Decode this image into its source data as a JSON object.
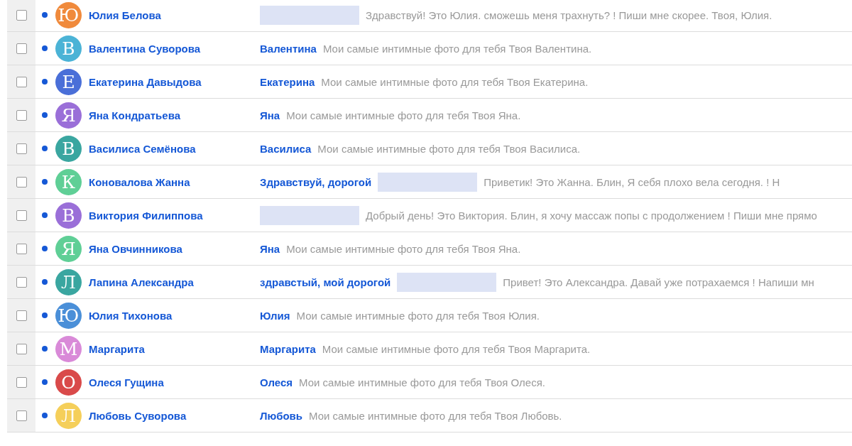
{
  "messages": [
    {
      "sender": "Юлия Белова",
      "initial": "Ю",
      "color": "#f08a3c",
      "unread": true,
      "checked": false,
      "parts": [
        {
          "kind": "redacted"
        },
        {
          "kind": "preview",
          "text": "Здравствуй! Это Юлия. сможешь меня трахнуть? ! Пиши мне скорее. Твоя, Юлия."
        }
      ]
    },
    {
      "sender": "Валентина Суворова",
      "initial": "В",
      "color": "#4bb3d6",
      "unread": true,
      "checked": false,
      "parts": [
        {
          "kind": "subject",
          "text": "Валентина"
        },
        {
          "kind": "preview",
          "text": "Мои самые интимные фото для тебя Твоя Валентина."
        }
      ]
    },
    {
      "sender": "Екатерина Давыдова",
      "initial": "Е",
      "color": "#4a6fd8",
      "unread": true,
      "checked": false,
      "parts": [
        {
          "kind": "subject",
          "text": "Екатерина"
        },
        {
          "kind": "preview",
          "text": "Мои самые интимные фото для тебя Твоя Екатерина."
        }
      ]
    },
    {
      "sender": "Яна Кондратьева",
      "initial": "Я",
      "color": "#9a6fd8",
      "unread": true,
      "checked": false,
      "parts": [
        {
          "kind": "subject",
          "text": "Яна"
        },
        {
          "kind": "preview",
          "text": "Мои самые интимные фото для тебя Твоя Яна."
        }
      ]
    },
    {
      "sender": "Василиса Семёнова",
      "initial": "В",
      "color": "#3aa6a0",
      "unread": true,
      "checked": false,
      "parts": [
        {
          "kind": "subject",
          "text": "Василиса"
        },
        {
          "kind": "preview",
          "text": "Мои самые интимные фото для тебя Твоя Василиса."
        }
      ]
    },
    {
      "sender": "Коновалова Жанна",
      "initial": "К",
      "color": "#5fcf96",
      "unread": true,
      "checked": false,
      "parts": [
        {
          "kind": "subject",
          "text": "Здравствуй, дорогой"
        },
        {
          "kind": "redacted"
        },
        {
          "kind": "preview",
          "text": "Приветик! Это Жанна. Блин, Я себя плохо вела сегодня. ! Н"
        }
      ]
    },
    {
      "sender": "Виктория Филиппова",
      "initial": "В",
      "color": "#9a6fd8",
      "unread": true,
      "checked": false,
      "parts": [
        {
          "kind": "redacted"
        },
        {
          "kind": "preview",
          "text": "Добрый день! Это Виктория. Блин, я хочу массаж попы с продолжением ! Пиши мне прямо"
        }
      ]
    },
    {
      "sender": "Яна Овчинникова",
      "initial": "Я",
      "color": "#5fcf96",
      "unread": true,
      "checked": false,
      "parts": [
        {
          "kind": "subject",
          "text": "Яна"
        },
        {
          "kind": "preview",
          "text": "Мои самые интимные фото для тебя Твоя Яна."
        }
      ]
    },
    {
      "sender": "Лапина Александра",
      "initial": "Л",
      "color": "#3aa6a0",
      "unread": true,
      "checked": false,
      "parts": [
        {
          "kind": "subject",
          "text": "здравстый, мой дорогой"
        },
        {
          "kind": "redacted"
        },
        {
          "kind": "preview",
          "text": "Привет! Это Александра. Давай уже потрахаемся ! Напиши мн"
        }
      ]
    },
    {
      "sender": "Юлия Тихонова",
      "initial": "Ю",
      "color": "#4a8fd8",
      "unread": true,
      "checked": false,
      "parts": [
        {
          "kind": "subject",
          "text": "Юлия"
        },
        {
          "kind": "preview",
          "text": "Мои самые интимные фото для тебя Твоя Юлия."
        }
      ]
    },
    {
      "sender": "Маргарита",
      "initial": "М",
      "color": "#d98ad8",
      "unread": true,
      "checked": false,
      "parts": [
        {
          "kind": "subject",
          "text": "Маргарита"
        },
        {
          "kind": "preview",
          "text": "Мои самые интимные фото для тебя Твоя Маргарита."
        }
      ]
    },
    {
      "sender": "Олеся Гущина",
      "initial": "О",
      "color": "#d94a4a",
      "unread": true,
      "checked": false,
      "parts": [
        {
          "kind": "subject",
          "text": "Олеся"
        },
        {
          "kind": "preview",
          "text": "Мои самые интимные фото для тебя Твоя Олеся."
        }
      ]
    },
    {
      "sender": "Любовь Суворова",
      "initial": "Л",
      "color": "#f5cf5a",
      "unread": true,
      "checked": false,
      "parts": [
        {
          "kind": "subject",
          "text": "Любовь"
        },
        {
          "kind": "preview",
          "text": "Мои самые интимные фото для тебя Твоя Любовь."
        }
      ]
    }
  ]
}
